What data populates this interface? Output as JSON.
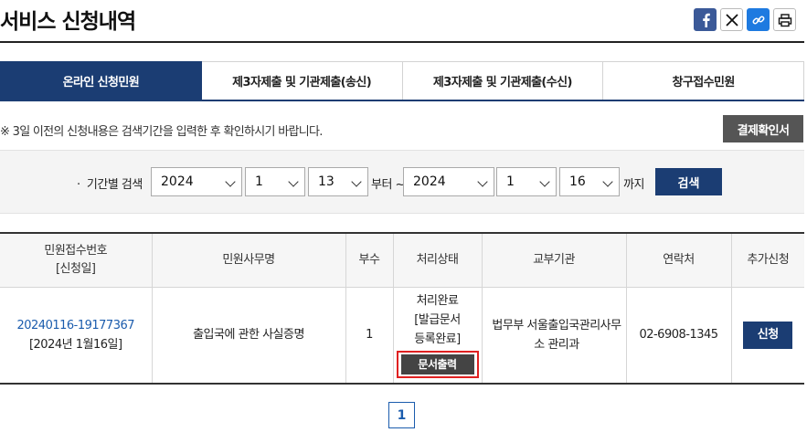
{
  "page": {
    "title": "서비스 신청내역"
  },
  "share": [
    {
      "name": "facebook-icon"
    },
    {
      "name": "x-icon"
    },
    {
      "name": "link-icon"
    },
    {
      "name": "print-icon"
    }
  ],
  "tabs": [
    {
      "label": "온라인 신청민원",
      "active": true
    },
    {
      "label": "제3자제출 및 기관제출(송신)",
      "active": false
    },
    {
      "label": "제3자제출 및 기관제출(수신)",
      "active": false
    },
    {
      "label": "창구접수민원",
      "active": false
    }
  ],
  "notice": "※ 3일 이전의 신청내용은 검색기간을 입력한 후 확인하시기 바랍니다.",
  "confirm_button": "결제확인서",
  "search": {
    "label": "기간별 검색",
    "from_year": "2024",
    "from_month": "1",
    "from_day": "13",
    "from_suffix": "부터 ~",
    "to_year": "2024",
    "to_month": "1",
    "to_day": "16",
    "to_suffix": "까지",
    "button": "검색"
  },
  "table": {
    "headers": [
      "민원접수번호",
      "[신청일]",
      "민원사무명",
      "부수",
      "처리상태",
      "교부기관",
      "연락처",
      "추가신청"
    ],
    "rows": [
      {
        "receipt_no": "20240116-19177367",
        "date": "[2024년 1월16일]",
        "service_name": "출입국에 관한 사실증명",
        "copies": "1",
        "status_line1": "처리완료",
        "status_line2": "[발급문서",
        "status_line3": "등록완료]",
        "print_button": "문서출력",
        "agency": "법무부 서울출입국관리사무소 관리과",
        "contact": "02-6908-1345",
        "apply_button": "신청"
      }
    ]
  },
  "pagination": {
    "current": "1"
  },
  "colors": {
    "navy": "#1b3d73",
    "link": "#1b5cad",
    "highlight": "#e02020"
  }
}
